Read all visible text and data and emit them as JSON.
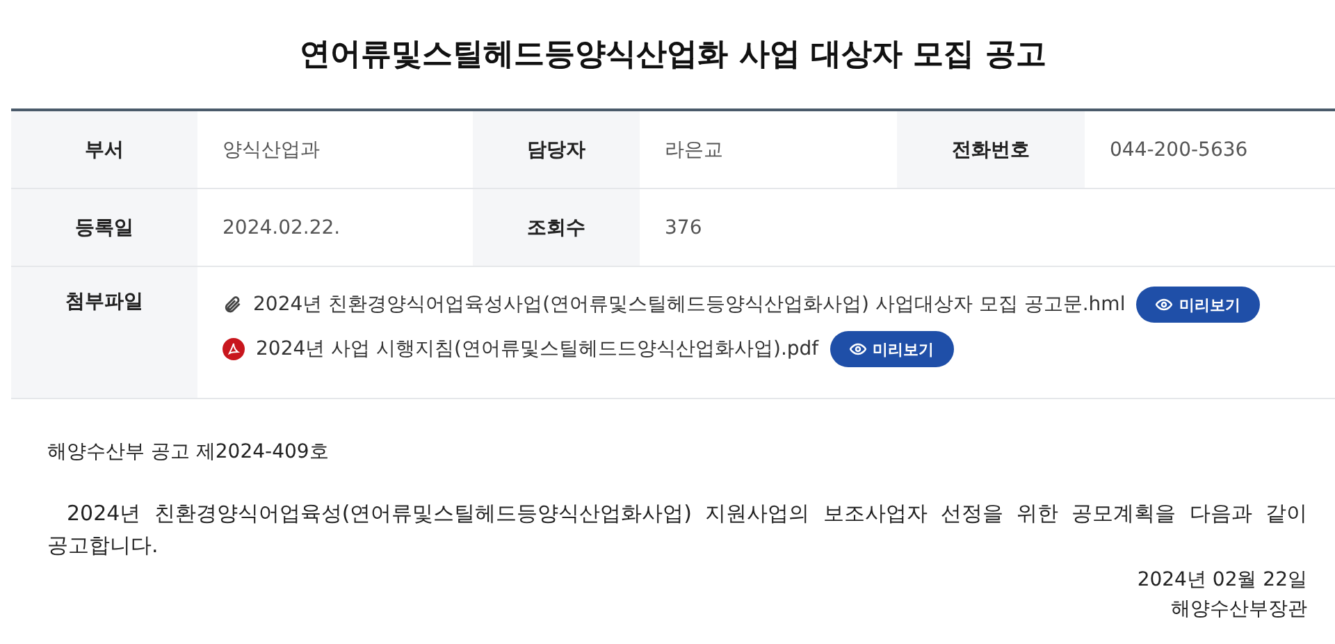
{
  "title": "연어류및스틸헤드등양식산업화 사업 대상자 모집 공고",
  "info_rows": [
    [
      {
        "label": "부서",
        "value": "양식산업과"
      },
      {
        "label": "담당자",
        "value": "라은교"
      },
      {
        "label": "전화번호",
        "value": "044-200-5636"
      }
    ],
    [
      {
        "label": "등록일",
        "value": "2024.02.22."
      },
      {
        "label": "조회수",
        "value": "376"
      }
    ]
  ],
  "attachments": {
    "label": "첨부파일",
    "files": [
      {
        "kind": "hwp",
        "name": "2024년 친환경양식어업육성사업(연어류및스틸헤드등양식산업화사업) 사업대상자 모집 공고문.hml",
        "button": "미리보기"
      },
      {
        "kind": "pdf",
        "name": "2024년 사업 시행지침(연어류및스틸헤드드양식산업화사업).pdf",
        "button": "미리보기"
      }
    ]
  },
  "notice_number": "해양수산부 공고 제2024-409호",
  "body": "2024년 친환경양식어업육성(연어류및스틸헤드등양식산업화사업) 지원사업의 보조사업자 선정을 위한 공모계획을 다음과 같이 공고합니다.",
  "date": "2024년 02월 22일",
  "signer": "해양수산부장관"
}
